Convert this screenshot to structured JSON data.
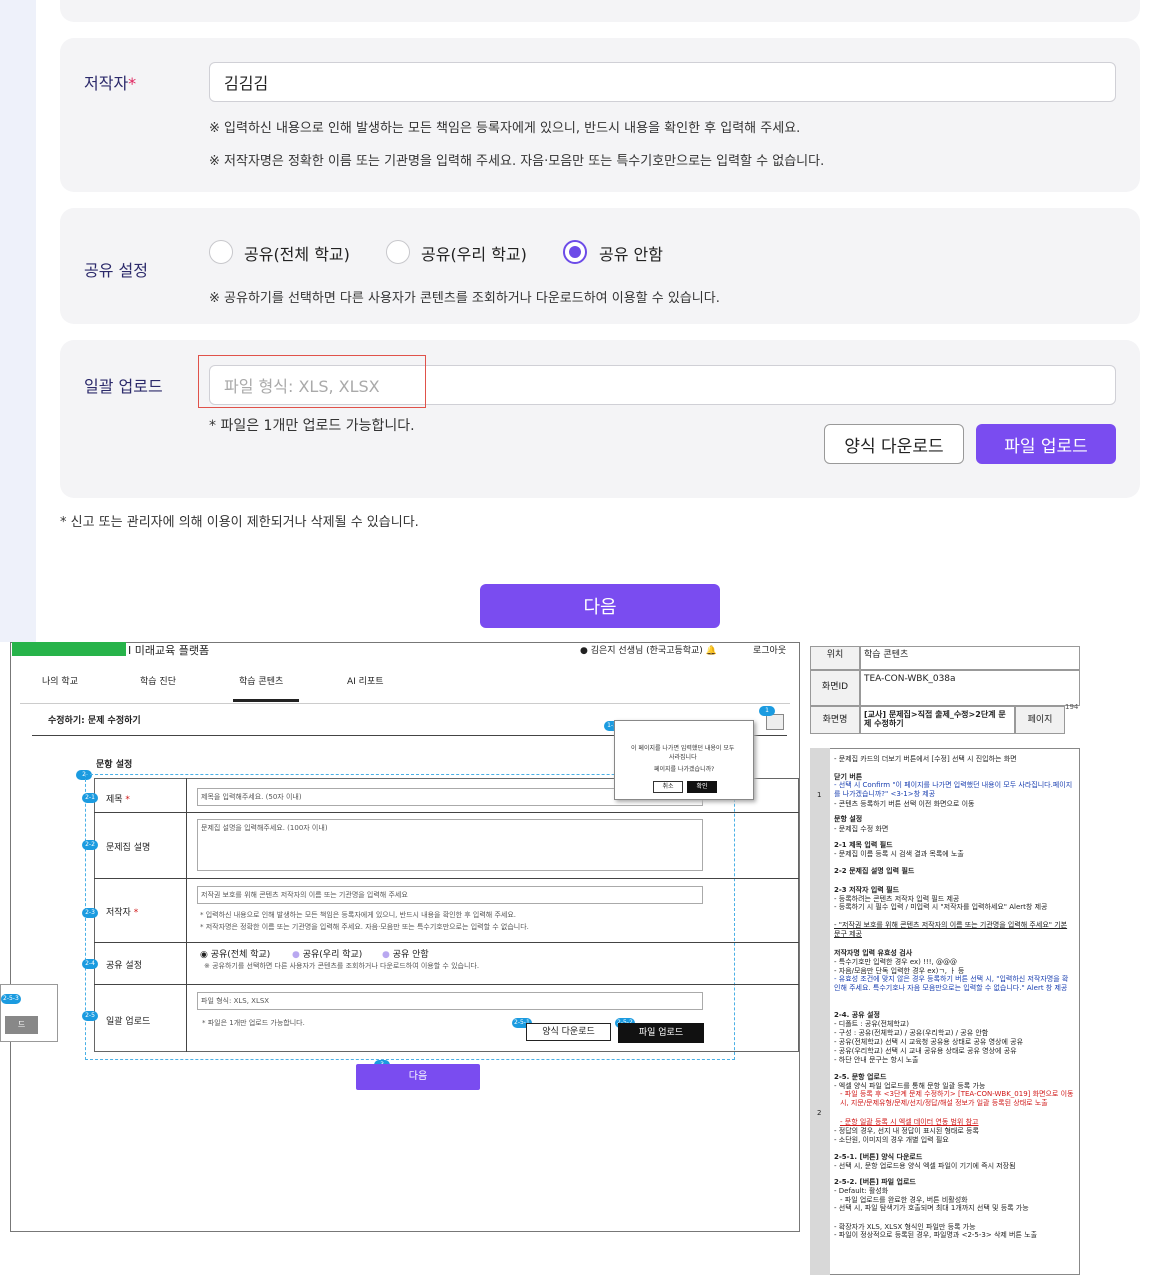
{
  "author": {
    "label": "저작자",
    "required_mark": "*",
    "value": "김김김",
    "note1": "※ 입력하신 내용으로 인해 발생하는 모든 책임은 등록자에게 있으니, 반드시 내용을 확인한 후 입력해 주세요.",
    "note2": "※ 저작자명은 정확한 이름 또는 기관명을 입력해 주세요. 자음·모음만 또는 특수기호만으로는 입력할 수 없습니다."
  },
  "share": {
    "label": "공유 설정",
    "options": [
      "공유(전체 학교)",
      "공유(우리 학교)",
      "공유 안함"
    ],
    "selected_index": 2,
    "note": "※ 공유하기를 선택하면 다른 사용자가 콘텐츠를 조회하거나 다운로드하여 이용할 수 있습니다."
  },
  "bulk": {
    "label": "일괄 업로드",
    "placeholder": "파일 형식: XLS, XLSX",
    "note": "* 파일은 1개만 업로드 가능합니다.",
    "download_button": "양식 다운로드",
    "upload_button": "파일 업로드"
  },
  "footer_note": "* 신고 또는 관리자에 의해 이용이 제한되거나 삭제될 수 있습니다.",
  "next_button": "다음",
  "colors": {
    "accent": "#7a4cf0",
    "label": "#2c2a6b",
    "card": "#f4f4f6",
    "highlight_box": "#e0524a"
  },
  "spec": {
    "platform": "I 미래교육 플랫폼",
    "user": "김은지 선생님 (한국고등학교)",
    "logout": "로그아웃",
    "nav": [
      "나의 학교",
      "학습 진단",
      "학습 콘텐츠",
      "AI 리포트"
    ],
    "page_title": "수정하기: 문제 수정하기",
    "section_title": "문항 설정",
    "rows": [
      {
        "badge": "2-1",
        "label": "제목 *",
        "placeholder": "제목을 입력해주세요. (50자 이내)"
      },
      {
        "badge": "2-2",
        "label": "문제집 설명",
        "placeholder": "문제집 설명을 입력해주세요. (100자 이내)"
      },
      {
        "badge": "2-3",
        "label": "저작자 *",
        "placeholder": "저작권 보호를 위해 콘텐츠 저작자의 이름 또는 기관명을 입력해 주세요"
      },
      {
        "badge": "2-4",
        "label": "공유 설정"
      },
      {
        "badge": "2-5",
        "label": "일괄 업로드",
        "placeholder": "파일 형식: XLS, XLSX"
      }
    ],
    "author_note1": "* 입력하신 내용으로 인해 발생하는 모든 책임은 등록자에게 있으니, 반드시 내용을 확인한 후 입력해 주세요.",
    "author_note2": "* 저작자명은 정확한 이름 또는 기관명을 입력해 주세요. 자음·모음만 또는 특수기호만으로는 입력할 수 없습니다.",
    "share_options": [
      "공유(전체 학교)",
      "공유(우리 학교)",
      "공유 안함"
    ],
    "share_note": "※ 공유하기를 선택하면 다른 사용자가 콘텐츠를 조회하거나 다운로드하여 이용할 수 있습니다.",
    "upload_note": "* 파일은 1개만 업로드 가능합니다.",
    "download_btn": "양식 다운로드",
    "upload_btn": "파일 업로드",
    "next_btn": "다음",
    "badge_download": "2-5-1",
    "badge_upload": "2-5-2",
    "badge_3": "3",
    "badge_2": "2",
    "badge_11": "1-1",
    "badge_1": "1",
    "badge_253": "2-5-3",
    "side_btn": "드",
    "dialog": {
      "line1": "이 페이지를 나가면 입력했던 내용이 모두",
      "line2": "사라집니다",
      "line3": "페이지를 나가겠습니까?",
      "cancel": "취소",
      "confirm": "확인"
    },
    "table": {
      "loc_label": "위치",
      "loc": "학습 콘텐츠",
      "id_label": "화면ID",
      "id": "TEA-CON-WBK_038a",
      "name_label": "화면명",
      "name": "[교사] 문제집>직접 출제_수정>2단계 문제 수정하기",
      "page_label": "페이지",
      "page_no": "194"
    },
    "desc": [
      "- 문제집 카드의 더보기 버튼에서 [수정] 선택 시 진입하는 화면",
      "닫기 버튼",
      "- 선택 시 Confirm \"이 페이지를 나가면 입력했던 내용이 모두 사라집니다.페이지를 나가겠습니까?\" <3-1>창 제공",
      "- 콘텐츠 등록하기 버튼 선택 이전 화면으로 이동",
      "문항 설정",
      "- 문제집 수정 화면",
      "2-1 제목 입력 필드",
      "- 문제집 이름 등록 시 검색 결과 목록에 노출",
      "2-2 문제집 설명 입력 필드",
      "2-3 저작자 입력 필드",
      "- 등록하려는 콘텐츠 저작자 입력 필드 제공",
      "- 등록하기 시 필수 입력 / 미입력 시 \"저작자를 입력하세요\" Alert창 제공",
      "- \"저작권 보호를 위해 콘텐츠 저작자의 이름 또는 기관명을 입력해 주세요\" 기본 문구 제공",
      "저작자명 입력 유효성 검사",
      "- 특수기호만 입력한 경우 ex) !!!, @@@",
      "- 자음/모음만 단독 입력한 경우 ex)ㄱ, ㅏ 등",
      "- 유효성 조건에 맞지 않은 경우 등록하기 버튼 선택 시, \"입력하신 저작자명을 확인해 주세요. 특수기호나 자음 모음만으로는 입력할 수 없습니다.\" Alert 창 제공",
      "2-4. 공유 설정",
      "- 디폴트 : 공유(전체학교)",
      "- 구성 : 공유(전체학교) / 공유(우리학교) / 공유 안함",
      "- 공유(전체학교) 선택 시 교육청 공유용 상태로 공유 영상에 공유",
      "- 공유(우리학교) 선택 시 교내 공유용 상태로 공유 영상에 공유",
      "- 하단 안내 문구는 항시 노출",
      "2-5. 문항 업로드",
      "- 엑셀 양식 파일 업로드를 통해 문항 일괄 등록 가능",
      "- 파일 등록 후 <3단계 문제 수정하기> [TEA-CON-WBK_019] 화면으로 이동 시, 지문/문제유형/문제/선지/정답/해설 정보가 일괄 등록된 상태로 노출",
      "- 문항 일괄 등록 시 엑셀 데이터 연동 범위 참고",
      "- 정답의 경우, 선지 내 정답이 표시된 형태로 등록",
      "- 소단원, 이미지의 경우 개별 입력 필요",
      "2-5-1. [버튼] 양식 다운로드",
      "- 선택 시, 문항 업로드용 양식 엑셀 파일이 기기에 즉시 저장됨",
      "2-5-2. [버튼] 파일 업로드",
      "- Default: 활성화",
      "- 파일 업로드를 완료한 경우, 버튼 비활성화",
      "- 선택 시, 파일 탐색기가 호출되며 최대 1개까지 선택 및 등록 가능",
      "- 확장자가 XLS, XLSX 형식인 파일만 등록 가능",
      "- 파일이 정상적으로 등록된 경우, 파일명과 <2-5-3> 삭제 버튼 노출"
    ],
    "row_numbers": [
      "1",
      "2"
    ]
  }
}
